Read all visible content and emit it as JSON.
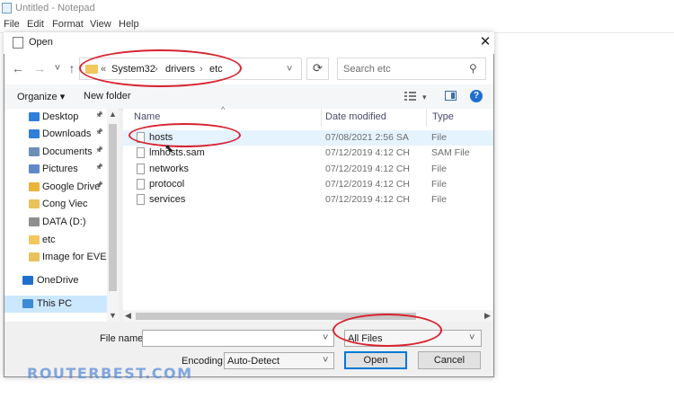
{
  "notepad": {
    "title": "Untitled - Notepad",
    "menu": [
      "File",
      "Edit",
      "Format",
      "View",
      "Help"
    ]
  },
  "dialog": {
    "title": "Open",
    "close_glyph": "✕",
    "nav": {
      "back": "←",
      "forward": "→",
      "recent": "˅",
      "up": "↑"
    },
    "address": {
      "overflow": "«",
      "crumbs": [
        "System32",
        "drivers",
        "etc"
      ],
      "sep": "›",
      "dropdown": "˅"
    },
    "refresh_glyph": "⟳",
    "search": {
      "placeholder": "Search etc",
      "icon": "⚲"
    },
    "toolbar": {
      "organize": "Organize ▾",
      "new_folder": "New folder",
      "view_arrow": "▾",
      "help": "?"
    },
    "sidebar": [
      {
        "label": "Desktop",
        "pinned": true,
        "icon": "desktop-icon",
        "color": "#2f7fd8"
      },
      {
        "label": "Downloads",
        "pinned": true,
        "icon": "downloads-icon",
        "color": "#2f7fd8"
      },
      {
        "label": "Documents",
        "pinned": true,
        "icon": "documents-icon",
        "color": "#6b8fb8"
      },
      {
        "label": "Pictures",
        "pinned": true,
        "icon": "pictures-icon",
        "color": "#5f88c9"
      },
      {
        "label": "Google Drive",
        "pinned": true,
        "icon": "google-drive-icon",
        "color": "#e8b53a"
      },
      {
        "label": "Cong Viec",
        "pinned": false,
        "icon": "folder-check-icon",
        "color": "#e8c25a"
      },
      {
        "label": "DATA (D:)",
        "pinned": false,
        "icon": "drive-icon",
        "color": "#8e8e8e"
      },
      {
        "label": "etc",
        "pinned": false,
        "icon": "folder-icon",
        "color": "#f2c75c"
      },
      {
        "label": "Image for EVE N",
        "pinned": false,
        "icon": "folder-check-icon",
        "color": "#e8c25a"
      },
      {
        "label": "OneDrive",
        "pinned": false,
        "icon": "onedrive-icon",
        "color": "#1f6fd1"
      },
      {
        "label": "This PC",
        "pinned": false,
        "icon": "this-pc-icon",
        "color": "#3a8ad6",
        "selected": true
      }
    ],
    "pin_glyph": "📌",
    "columns": {
      "name": "Name",
      "date": "Date modified",
      "type": "Type"
    },
    "files": [
      {
        "name": "hosts",
        "date": "07/08/2021 2:56 SA",
        "type": "File",
        "hovered": true
      },
      {
        "name": "lmhosts.sam",
        "date": "07/12/2019 4:12 CH",
        "type": "SAM File"
      },
      {
        "name": "networks",
        "date": "07/12/2019 4:12 CH",
        "type": "File"
      },
      {
        "name": "protocol",
        "date": "07/12/2019 4:12 CH",
        "type": "File"
      },
      {
        "name": "services",
        "date": "07/12/2019 4:12 CH",
        "type": "File"
      }
    ],
    "footer": {
      "file_name_label": "File name:",
      "file_name_value": "",
      "filter_value": "All Files",
      "encoding_label": "Encoding:",
      "encoding_value": "Auto-Detect",
      "open_label": "Open",
      "cancel_label": "Cancel"
    }
  },
  "watermark": "ROUTERBEST.COM",
  "colors": {
    "accent": "#0078d7",
    "annotation": "#d7232f",
    "selection": "#e5f3ff"
  }
}
